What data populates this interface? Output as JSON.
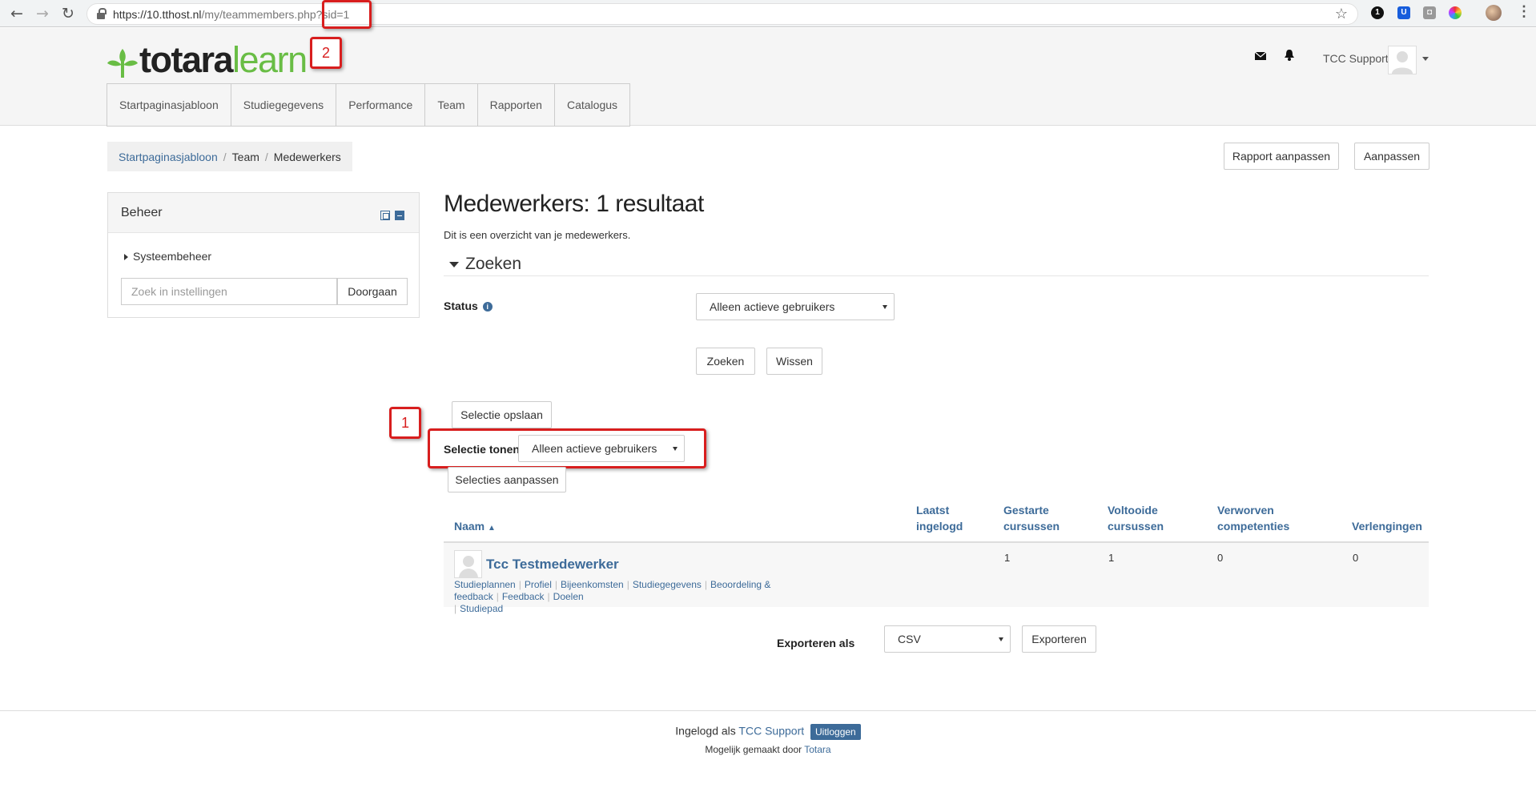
{
  "browser": {
    "url_host": "https://10.tthost.nl",
    "url_path": "/my/teammembers.php?sid=1"
  },
  "header": {
    "logo_primary": "totara",
    "logo_secondary": "learn",
    "user_name": "TCC Support",
    "nav_tabs": [
      "Startpaginasjabloon",
      "Studiegegevens",
      "Performance",
      "Team",
      "Rapporten",
      "Catalogus"
    ]
  },
  "breadcrumb": [
    "Startpaginasjabloon",
    "Team",
    "Medewerkers"
  ],
  "page_actions": {
    "report_edit": "Rapport aanpassen",
    "edit": "Aanpassen"
  },
  "admin_block": {
    "title": "Beheer",
    "tree_item": "Systeembeheer",
    "search_placeholder": "Zoek in instellingen",
    "search_button": "Doorgaan"
  },
  "main": {
    "title": "Medewerkers: 1 resultaat",
    "description": "Dit is een overzicht van je medewerkers.",
    "search_legend": "Zoeken",
    "status_label": "Status",
    "status_value": "Alleen actieve gebruikers",
    "search_button": "Zoeken",
    "clear_button": "Wissen",
    "save_selection": "Selectie opslaan",
    "show_selection_label": "Selectie tonen",
    "show_selection_value": "Alleen actieve gebruikers",
    "edit_selections": "Selecties aanpassen"
  },
  "table": {
    "headers": {
      "name": "Naam",
      "last_login_1": "Laatst",
      "last_login_2": "ingelogd",
      "started_1": "Gestarte",
      "started_2": "cursussen",
      "completed_1": "Voltooide",
      "completed_2": "cursussen",
      "competencies_1": "Verworven",
      "competencies_2": "competenties",
      "extensions": "Verlengingen"
    },
    "rows": [
      {
        "name": "Tcc Testmedewerker",
        "links": [
          "Studieplannen",
          "Profiel",
          "Bijeenkomsten",
          "Studiegegevens",
          "Beoordeling & feedback",
          "Feedback",
          "Doelen",
          "Studiepad"
        ],
        "last_login": "",
        "started": "1",
        "completed": "1",
        "competencies": "0",
        "extensions": "0"
      }
    ]
  },
  "export": {
    "label": "Exporteren als",
    "format": "CSV",
    "button": "Exporteren"
  },
  "footer": {
    "logged_in_as": "Ingelogd als",
    "user": "TCC Support",
    "logout": "Uitloggen",
    "powered_by": "Mogelijk gemaakt door",
    "powered_link": "Totara"
  },
  "annotations": {
    "badge_1": "1",
    "badge_2": "2"
  },
  "colors": {
    "accent": "#3d6b99",
    "logo_green": "#69bd45",
    "annotation_red": "#d81e1e"
  }
}
